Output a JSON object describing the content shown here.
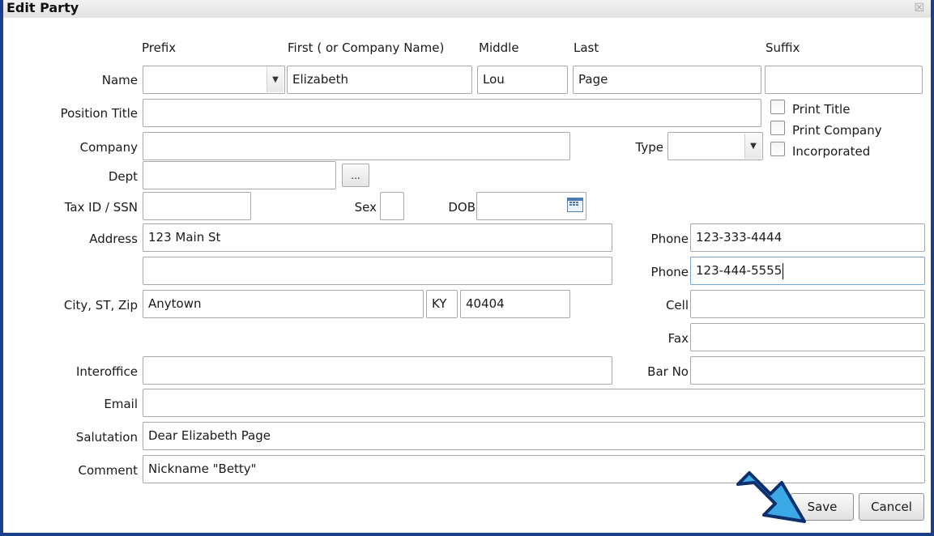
{
  "window": {
    "title": "Edit Party",
    "close_glyph": "☒"
  },
  "headers": {
    "prefix": "Prefix",
    "first": "First ( or Company Name)",
    "middle": "Middle",
    "last": "Last",
    "suffix": "Suffix"
  },
  "labels": {
    "name": "Name",
    "position_title": "Position Title",
    "company": "Company",
    "type": "Type",
    "dept": "Dept",
    "tax_id": "Tax ID / SSN",
    "sex": "Sex",
    "dob": "DOB",
    "address": "Address",
    "phone1": "Phone",
    "phone2": "Phone",
    "city_st_zip": "City, ST, Zip",
    "cell": "Cell",
    "fax": "Fax",
    "interoffice": "Interoffice",
    "bar_no": "Bar No",
    "email": "Email",
    "salutation": "Salutation",
    "comment": "Comment"
  },
  "checkboxes": {
    "print_title": "Print Title",
    "print_company": "Print Company",
    "incorporated": "Incorporated"
  },
  "values": {
    "prefix": "",
    "first": "Elizabeth",
    "middle": "Lou",
    "last": "Page",
    "suffix": "",
    "position_title": "",
    "company": "",
    "type": "",
    "dept": "",
    "tax_id": "",
    "sex": "",
    "dob": "",
    "address1": "123 Main St",
    "address2": "",
    "phone1": "123-333-4444",
    "phone2": "123-444-5555",
    "city": "Anytown",
    "state": "KY",
    "zip": "40404",
    "cell": "",
    "fax": "",
    "interoffice": "",
    "bar_no": "",
    "email": "",
    "salutation": "Dear Elizabeth Page",
    "comment": "Nickname \"Betty\""
  },
  "buttons": {
    "browse_dept": "...",
    "save": "Save",
    "cancel": "Cancel"
  },
  "colors": {
    "frame": "#1c3f8c",
    "arrow_fill": "#3aa9e6",
    "arrow_stroke": "#0d2f6e"
  },
  "icons": {
    "dropdown": "chevron-down-icon",
    "calendar": "calendar-icon",
    "close": "close-icon",
    "pointer": "arrow-pointer-icon"
  }
}
